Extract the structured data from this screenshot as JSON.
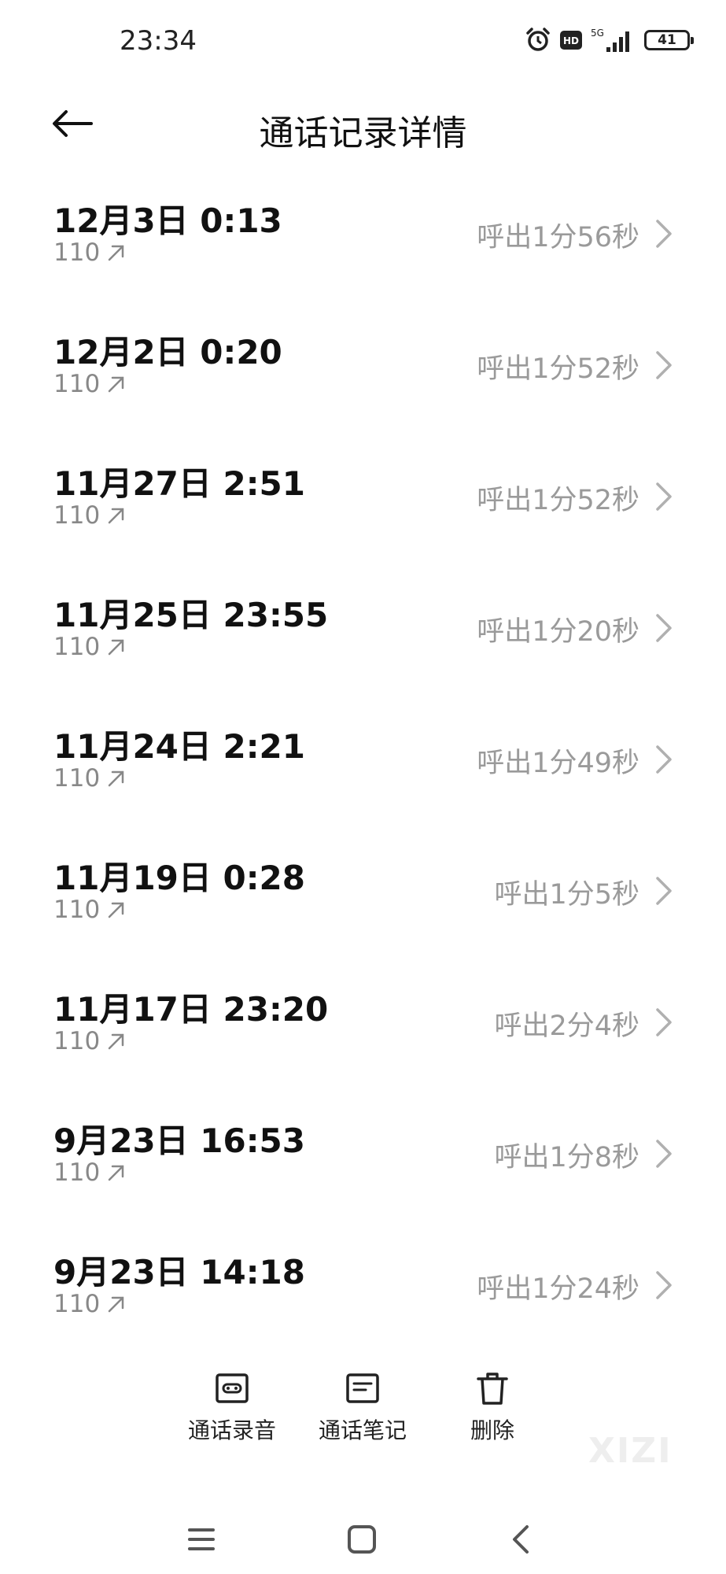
{
  "status_bar": {
    "time": "23:34",
    "icons": [
      "alarm-icon",
      "hd-icon",
      "5g-signal-icon",
      "battery-icon"
    ],
    "hd_label": "HD",
    "network_label": "5G",
    "battery_level": "41"
  },
  "header": {
    "title": "通话记录详情",
    "back_icon": "arrow-left-icon"
  },
  "calls": [
    {
      "date": "12月3日 0:13",
      "number": "110",
      "duration": "呼出1分56秒"
    },
    {
      "date": "12月2日 0:20",
      "number": "110",
      "duration": "呼出1分52秒"
    },
    {
      "date": "11月27日 2:51",
      "number": "110",
      "duration": "呼出1分52秒"
    },
    {
      "date": "11月25日 23:55",
      "number": "110",
      "duration": "呼出1分20秒"
    },
    {
      "date": "11月24日 2:21",
      "number": "110",
      "duration": "呼出1分49秒"
    },
    {
      "date": "11月19日 0:28",
      "number": "110",
      "duration": "呼出1分5秒"
    },
    {
      "date": "11月17日 23:20",
      "number": "110",
      "duration": "呼出2分4秒"
    },
    {
      "date": "9月23日 16:53",
      "number": "110",
      "duration": "呼出1分8秒"
    },
    {
      "date": "9月23日 14:18",
      "number": "110",
      "duration": "呼出1分24秒"
    }
  ],
  "actions": {
    "recording_label": "通话录音",
    "notes_label": "通话笔记",
    "delete_label": "删除"
  },
  "watermark": "XIZI",
  "nav": {
    "menu_icon": "menu-icon",
    "home_icon": "home-icon",
    "back_icon": "back-icon"
  },
  "colors": {
    "text_primary": "#111111",
    "text_secondary": "#888888",
    "duration_gray": "#9a9a9a",
    "background": "#ffffff"
  }
}
